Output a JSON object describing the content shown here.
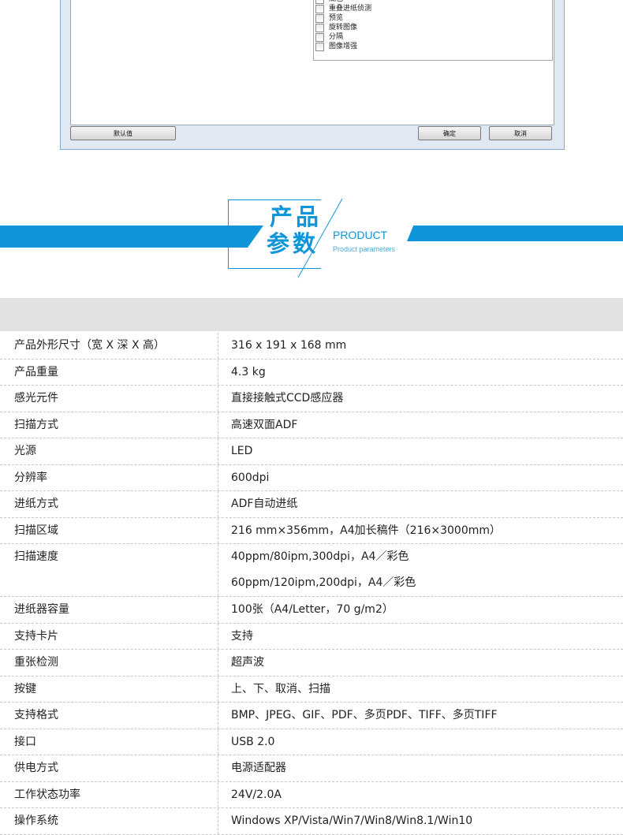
{
  "dialog": {
    "options": [
      "底色",
      "重叠进纸侦测",
      "预览",
      "旋转图像",
      "分隔",
      "图像增强"
    ],
    "default_button": "默认值",
    "ok_button": "确定",
    "cancel_button": "取消"
  },
  "banner": {
    "title_cn_line1": "产品",
    "title_cn_line2": "参数",
    "title_en": "PRODUCT",
    "subtitle_en": "Product parameters",
    "accent_color": "#0e95da"
  },
  "specs": [
    {
      "label": "产品外形尺寸（宽 X 深 X 高）",
      "values": [
        "316 x 191 x 168 mm"
      ]
    },
    {
      "label": "产品重量",
      "values": [
        "4.3 kg"
      ]
    },
    {
      "label": "感光元件",
      "values": [
        "直接接触式CCD感应器"
      ]
    },
    {
      "label": "扫描方式",
      "values": [
        "高速双面ADF"
      ]
    },
    {
      "label": "光源",
      "values": [
        "LED"
      ]
    },
    {
      "label": "分辨率",
      "values": [
        "600dpi"
      ]
    },
    {
      "label": "进纸方式",
      "values": [
        "ADF自动进纸"
      ]
    },
    {
      "label": "扫描区域",
      "values": [
        "216 mm×356mm，A4加长稿件（216×3000mm）"
      ]
    },
    {
      "label": "扫描速度",
      "values": [
        "40ppm/80ipm,300dpi，A4／彩色",
        "60ppm/120ipm,200dpi，A4／彩色"
      ]
    },
    {
      "label": "进纸器容量",
      "values": [
        "100张（A4/Letter，70 g/m2）"
      ]
    },
    {
      "label": "支持卡片",
      "values": [
        "支持"
      ]
    },
    {
      "label": "重张检测",
      "values": [
        "超声波"
      ]
    },
    {
      "label": "按键",
      "values": [
        "上、下、取消、扫描"
      ]
    },
    {
      "label": "支持格式",
      "values": [
        "BMP、JPEG、GIF、PDF、多页PDF、TIFF、多页TIFF"
      ]
    },
    {
      "label": "接口",
      "values": [
        "USB 2.0"
      ]
    },
    {
      "label": "供电方式",
      "values": [
        "电源适配器"
      ]
    },
    {
      "label": "工作状态功率",
      "values": [
        "24V/2.0A"
      ]
    },
    {
      "label": "操作系统",
      "values": [
        "Windows XP/Vista/Win7/Win8/Win8.1/Win10"
      ]
    }
  ]
}
